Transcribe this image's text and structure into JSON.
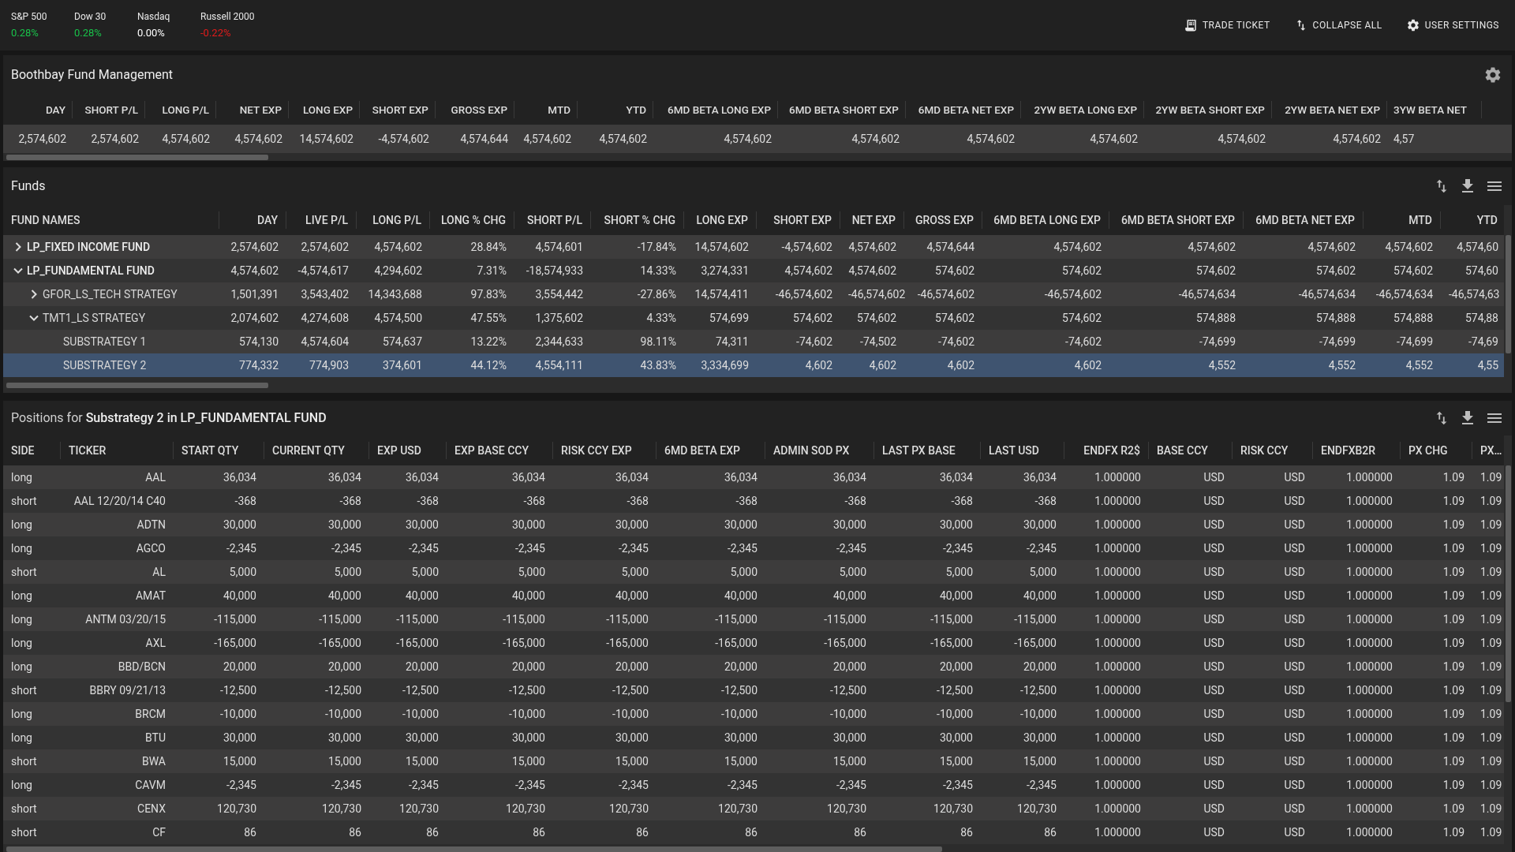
{
  "indices": [
    {
      "name": "S&P 500",
      "change": "0.28%",
      "color": "#19c24a"
    },
    {
      "name": "Dow 30",
      "change": "0.28%",
      "color": "#19c24a"
    },
    {
      "name": "Nasdaq",
      "change": "0.00%",
      "color": "#ffffff"
    },
    {
      "name": "Russell 2000",
      "change": "-0.22%",
      "color": "#e21b1b"
    }
  ],
  "toolbar": [
    {
      "label": "TRADE TICKET",
      "kind": "ticket"
    },
    {
      "label": "COLLAPSE ALL",
      "kind": "collapse"
    },
    {
      "label": "USER SETTINGS",
      "kind": "settings"
    }
  ],
  "summary": {
    "title": "Boothbay Fund Management",
    "columns": [
      "DAY",
      "SHORT P/L",
      "LONG P/L",
      "NET EXP",
      "LONG EXP",
      "SHORT EXP",
      "GROSS EXP",
      "MTD",
      "YTD",
      "6MD BETA LONG EXP",
      "6MD BETA SHORT EXP",
      "6MD BETA NET EXP",
      "2YW BETA LONG EXP",
      "2YW BETA SHORT EXP",
      "2YW BETA NET EXP",
      "3YW BETA NET"
    ],
    "values": [
      "2,574,602",
      "2,574,602",
      "4,574,602",
      "4,574,602",
      "14,574,602",
      "-4,574,602",
      "4,574,644",
      "4,574,602",
      "4,574,602",
      "4,574,602",
      "4,574,602",
      "4,574,602",
      "4,574,602",
      "4,574,602",
      "4,574,602",
      "4,57"
    ]
  },
  "funds": {
    "title": "Funds",
    "name_column": "FUND NAMES",
    "columns": [
      "DAY",
      "LIVE P/L",
      "LONG P/L",
      "LONG % CHG",
      "SHORT P/L",
      "SHORT % CHG",
      "LONG EXP",
      "SHORT EXP",
      "NET EXP",
      "GROSS EXP",
      "6MD BETA LONG EXP",
      "6MD BETA SHORT EXP",
      "6MD BETA NET EXP",
      "MTD",
      "YTD"
    ],
    "rows": [
      {
        "name": "LP_FIXED INCOME FUND",
        "expanded": false,
        "selected": false,
        "cells": [
          "2,574,602",
          "2,574,602",
          "4,574,602",
          "28.84%",
          "4,574,601",
          "-17.84%",
          "14,574,602",
          "-4,574,602",
          "4,574,602",
          "4,574,644",
          "4,574,602",
          "4,574,602",
          "4,574,602",
          "4,574,602",
          "4,574,60"
        ]
      },
      {
        "name": "LP_FUNDAMENTAL FUND",
        "expanded": true,
        "selected": false,
        "cells": [
          "4,574,602",
          "-4,574,617",
          "4,294,602",
          "7.31%",
          "-18,574,933",
          "14.33%",
          "3,274,331",
          "4,574,602",
          "4,574,602",
          "574,602",
          "574,602",
          "574,602",
          "574,602",
          "574,602",
          "574,60"
        ],
        "children": [
          {
            "name": "GFOR_LS_TECH STRATEGY",
            "expanded": false,
            "selected": false,
            "cells": [
              "1,501,391",
              "3,543,402",
              "14,343,688",
              "97.83%",
              "3,554,442",
              "-27.86%",
              "14,574,411",
              "-46,574,602",
              "-46,574,602",
              "-46,574,602",
              "-46,574,602",
              "-46,574,634",
              "-46,574,634",
              "-46,574,634",
              "-46,574,63"
            ]
          },
          {
            "name": "TMT1_LS STRATEGY",
            "expanded": true,
            "selected": false,
            "cells": [
              "2,074,602",
              "4,274,608",
              "4,574,500",
              "47.55%",
              "1,375,602",
              "4.33%",
              "574,699",
              "574,602",
              "574,602",
              "574,602",
              "574,602",
              "574,888",
              "574,888",
              "574,888",
              "574,88"
            ],
            "children": [
              {
                "name": "SUBSTRATEGY 1",
                "selected": false,
                "cells": [
                  "574,130",
                  "4,574,604",
                  "574,637",
                  "13.22%",
                  "2,344,633",
                  "98.11%",
                  "74,311",
                  "-74,602",
                  "-74,502",
                  "-74,602",
                  "-74,602",
                  "-74,699",
                  "-74,699",
                  "-74,699",
                  "-74,69"
                ]
              },
              {
                "name": "SUBSTRATEGY 2",
                "selected": true,
                "cells": [
                  "774,332",
                  "774,903",
                  "374,601",
                  "44.12%",
                  "4,554,111",
                  "43.83%",
                  "3,334,699",
                  "4,602",
                  "4,602",
                  "4,602",
                  "4,602",
                  "4,552",
                  "4,552",
                  "4,552",
                  "4,55"
                ]
              }
            ]
          }
        ]
      }
    ]
  },
  "positions": {
    "title": "Positions for **Substrategy 2 in LP_FUNDAMENTAL FUND**",
    "columns": [
      "SIDE",
      "TICKER",
      "START QTY",
      "CURRENT QTY",
      "EXP USD",
      "EXP BASE CCY",
      "RISK CCY EXP",
      "6MD BETA EXP",
      "ADMIN SOD PX",
      "LAST PX BASE",
      "LAST USD",
      "ENDFX R2$",
      "BASE CCY",
      "RISK CCY",
      "ENDFXB2R",
      "PX CHG",
      "PX…"
    ],
    "rows": [
      [
        "long",
        "AAL",
        "36,034",
        "36,034",
        "36,034",
        "36,034",
        "36,034",
        "36,034",
        "36,034",
        "36,034",
        "36,034",
        "1.000000",
        "USD",
        "USD",
        "1.000000",
        "1.09",
        "1.09"
      ],
      [
        "short",
        "AAL 12/20/14 C40",
        "-368",
        "-368",
        "-368",
        "-368",
        "-368",
        "-368",
        "-368",
        "-368",
        "-368",
        "1.000000",
        "USD",
        "USD",
        "1.000000",
        "1.09",
        "1.09"
      ],
      [
        "long",
        "ADTN",
        "30,000",
        "30,000",
        "30,000",
        "30,000",
        "30,000",
        "30,000",
        "30,000",
        "30,000",
        "30,000",
        "1.000000",
        "USD",
        "USD",
        "1.000000",
        "1.09",
        "1.09"
      ],
      [
        "long",
        "AGCO",
        "-2,345",
        "-2,345",
        "-2,345",
        "-2,345",
        "-2,345",
        "-2,345",
        "-2,345",
        "-2,345",
        "-2,345",
        "1.000000",
        "USD",
        "USD",
        "1.000000",
        "1.09",
        "1.09"
      ],
      [
        "short",
        "AL",
        "5,000",
        "5,000",
        "5,000",
        "5,000",
        "5,000",
        "5,000",
        "5,000",
        "5,000",
        "5,000",
        "1.000000",
        "USD",
        "USD",
        "1.000000",
        "1.09",
        "1.09"
      ],
      [
        "long",
        "AMAT",
        "40,000",
        "40,000",
        "40,000",
        "40,000",
        "40,000",
        "40,000",
        "40,000",
        "40,000",
        "40,000",
        "1.000000",
        "USD",
        "USD",
        "1.000000",
        "1.09",
        "1.09"
      ],
      [
        "long",
        "ANTM 03/20/15",
        "-115,000",
        "-115,000",
        "-115,000",
        "-115,000",
        "-115,000",
        "-115,000",
        "-115,000",
        "-115,000",
        "-115,000",
        "1.000000",
        "USD",
        "USD",
        "1.000000",
        "1.09",
        "1.09"
      ],
      [
        "long",
        "AXL",
        "-165,000",
        "-165,000",
        "-165,000",
        "-165,000",
        "-165,000",
        "-165,000",
        "-165,000",
        "-165,000",
        "-165,000",
        "1.000000",
        "USD",
        "USD",
        "1.000000",
        "1.09",
        "1.09"
      ],
      [
        "long",
        "BBD/BCN",
        "20,000",
        "20,000",
        "20,000",
        "20,000",
        "20,000",
        "20,000",
        "20,000",
        "20,000",
        "20,000",
        "1.000000",
        "USD",
        "USD",
        "1.000000",
        "1.09",
        "1.09"
      ],
      [
        "short",
        "BBRY 09/21/13",
        "-12,500",
        "-12,500",
        "-12,500",
        "-12,500",
        "-12,500",
        "-12,500",
        "-12,500",
        "-12,500",
        "-12,500",
        "1.000000",
        "USD",
        "USD",
        "1.000000",
        "1.09",
        "1.09"
      ],
      [
        "long",
        "BRCM",
        "-10,000",
        "-10,000",
        "-10,000",
        "-10,000",
        "-10,000",
        "-10,000",
        "-10,000",
        "-10,000",
        "-10,000",
        "1.000000",
        "USD",
        "USD",
        "1.000000",
        "1.09",
        "1.09"
      ],
      [
        "long",
        "BTU",
        "30,000",
        "30,000",
        "30,000",
        "30,000",
        "30,000",
        "30,000",
        "30,000",
        "30,000",
        "30,000",
        "1.000000",
        "USD",
        "USD",
        "1.000000",
        "1.09",
        "1.09"
      ],
      [
        "short",
        "BWA",
        "15,000",
        "15,000",
        "15,000",
        "15,000",
        "15,000",
        "15,000",
        "15,000",
        "15,000",
        "15,000",
        "1.000000",
        "USD",
        "USD",
        "1.000000",
        "1.09",
        "1.09"
      ],
      [
        "long",
        "CAVM",
        "-2,345",
        "-2,345",
        "-2,345",
        "-2,345",
        "-2,345",
        "-2,345",
        "-2,345",
        "-2,345",
        "-2,345",
        "1.000000",
        "USD",
        "USD",
        "1.000000",
        "1.09",
        "1.09"
      ],
      [
        "short",
        "CENX",
        "120,730",
        "120,730",
        "120,730",
        "120,730",
        "120,730",
        "120,730",
        "120,730",
        "120,730",
        "120,730",
        "1.000000",
        "USD",
        "USD",
        "1.000000",
        "1.09",
        "1.09"
      ],
      [
        "short",
        "CF",
        "86",
        "86",
        "86",
        "86",
        "86",
        "86",
        "86",
        "86",
        "86",
        "1.000000",
        "USD",
        "USD",
        "1.000000",
        "1.09",
        "1.09"
      ]
    ]
  }
}
